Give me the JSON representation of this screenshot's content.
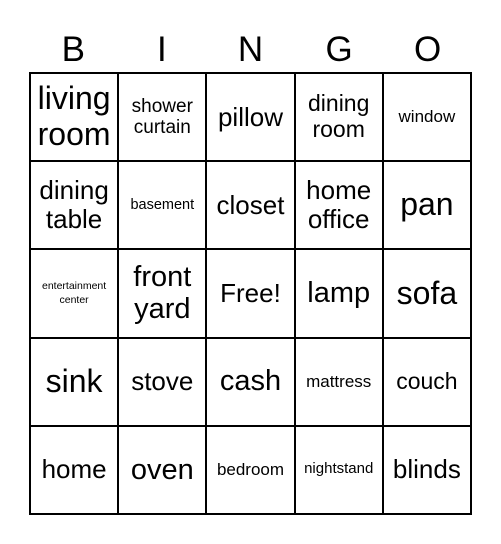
{
  "header": {
    "letters": [
      "B",
      "I",
      "N",
      "G",
      "O"
    ]
  },
  "cells": [
    "living room",
    "shower curtain",
    "pillow",
    "dining room",
    "window",
    "dining table",
    "basement",
    "closet",
    "home office",
    "pan",
    "entertainment center",
    "front yard",
    "Free!",
    "lamp",
    "sofa",
    "sink",
    "stove",
    "cash",
    "mattress",
    "couch",
    "home",
    "oven",
    "bedroom",
    "nightstand",
    "blinds"
  ]
}
